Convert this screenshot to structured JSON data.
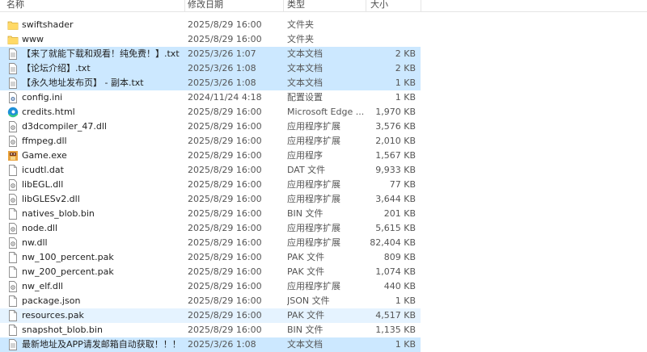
{
  "header": {
    "name": "名称",
    "date": "修改日期",
    "type": "类型",
    "size": "大小"
  },
  "files": [
    {
      "name": "swiftshader",
      "date": "2025/8/29 16:00",
      "type": "文件夹",
      "size": "",
      "icon": "folder-icon"
    },
    {
      "name": "www",
      "date": "2025/8/29 16:00",
      "type": "文件夹",
      "size": "",
      "icon": "folder-icon"
    },
    {
      "name": "【来了就能下载和观看！纯免费！】.txt",
      "date": "2025/3/26 1:07",
      "type": "文本文档",
      "size": "2 KB",
      "icon": "text-file-icon",
      "state": "sel"
    },
    {
      "name": "【论坛介绍】.txt",
      "date": "2025/3/26 1:08",
      "type": "文本文档",
      "size": "2 KB",
      "icon": "text-file-icon",
      "state": "sel"
    },
    {
      "name": "【永久地址发布页】 - 副本.txt",
      "date": "2025/3/26 1:08",
      "type": "文本文档",
      "size": "1 KB",
      "icon": "text-file-icon",
      "state": "sel"
    },
    {
      "name": "config.ini",
      "date": "2024/11/24 4:18",
      "type": "配置设置",
      "size": "1 KB",
      "icon": "config-file-icon"
    },
    {
      "name": "credits.html",
      "date": "2025/8/29 16:00",
      "type": "Microsoft Edge ...",
      "size": "1,970 KB",
      "icon": "edge-icon"
    },
    {
      "name": "d3dcompiler_47.dll",
      "date": "2025/8/29 16:00",
      "type": "应用程序扩展",
      "size": "3,576 KB",
      "icon": "dll-file-icon"
    },
    {
      "name": "ffmpeg.dll",
      "date": "2025/8/29 16:00",
      "type": "应用程序扩展",
      "size": "2,010 KB",
      "icon": "dll-file-icon"
    },
    {
      "name": "Game.exe",
      "date": "2025/8/29 16:00",
      "type": "应用程序",
      "size": "1,567 KB",
      "icon": "game-exe-icon"
    },
    {
      "name": "icudtl.dat",
      "date": "2025/8/29 16:00",
      "type": "DAT 文件",
      "size": "9,933 KB",
      "icon": "blank-file-icon"
    },
    {
      "name": "libEGL.dll",
      "date": "2025/8/29 16:00",
      "type": "应用程序扩展",
      "size": "77 KB",
      "icon": "dll-file-icon"
    },
    {
      "name": "libGLESv2.dll",
      "date": "2025/8/29 16:00",
      "type": "应用程序扩展",
      "size": "3,644 KB",
      "icon": "dll-file-icon"
    },
    {
      "name": "natives_blob.bin",
      "date": "2025/8/29 16:00",
      "type": "BIN 文件",
      "size": "201 KB",
      "icon": "blank-file-icon"
    },
    {
      "name": "node.dll",
      "date": "2025/8/29 16:00",
      "type": "应用程序扩展",
      "size": "5,615 KB",
      "icon": "dll-file-icon"
    },
    {
      "name": "nw.dll",
      "date": "2025/8/29 16:00",
      "type": "应用程序扩展",
      "size": "82,404 KB",
      "icon": "dll-file-icon"
    },
    {
      "name": "nw_100_percent.pak",
      "date": "2025/8/29 16:00",
      "type": "PAK 文件",
      "size": "809 KB",
      "icon": "blank-file-icon"
    },
    {
      "name": "nw_200_percent.pak",
      "date": "2025/8/29 16:00",
      "type": "PAK 文件",
      "size": "1,074 KB",
      "icon": "blank-file-icon"
    },
    {
      "name": "nw_elf.dll",
      "date": "2025/8/29 16:00",
      "type": "应用程序扩展",
      "size": "440 KB",
      "icon": "dll-file-icon"
    },
    {
      "name": "package.json",
      "date": "2025/8/29 16:00",
      "type": "JSON 文件",
      "size": "1 KB",
      "icon": "blank-file-icon"
    },
    {
      "name": "resources.pak",
      "date": "2025/8/29 16:00",
      "type": "PAK 文件",
      "size": "4,517 KB",
      "icon": "blank-file-icon",
      "state": "hl"
    },
    {
      "name": "snapshot_blob.bin",
      "date": "2025/8/29 16:00",
      "type": "BIN 文件",
      "size": "1,135 KB",
      "icon": "blank-file-icon"
    },
    {
      "name": "最新地址及APP请发邮箱自动获取！！！ ....",
      "date": "2025/3/26 1:08",
      "type": "文本文档",
      "size": "1 KB",
      "icon": "text-file-icon",
      "state": "sel"
    }
  ],
  "colors": {
    "selected": "#cce8ff",
    "hover": "#e5f3ff",
    "folder": "#f8d775"
  }
}
